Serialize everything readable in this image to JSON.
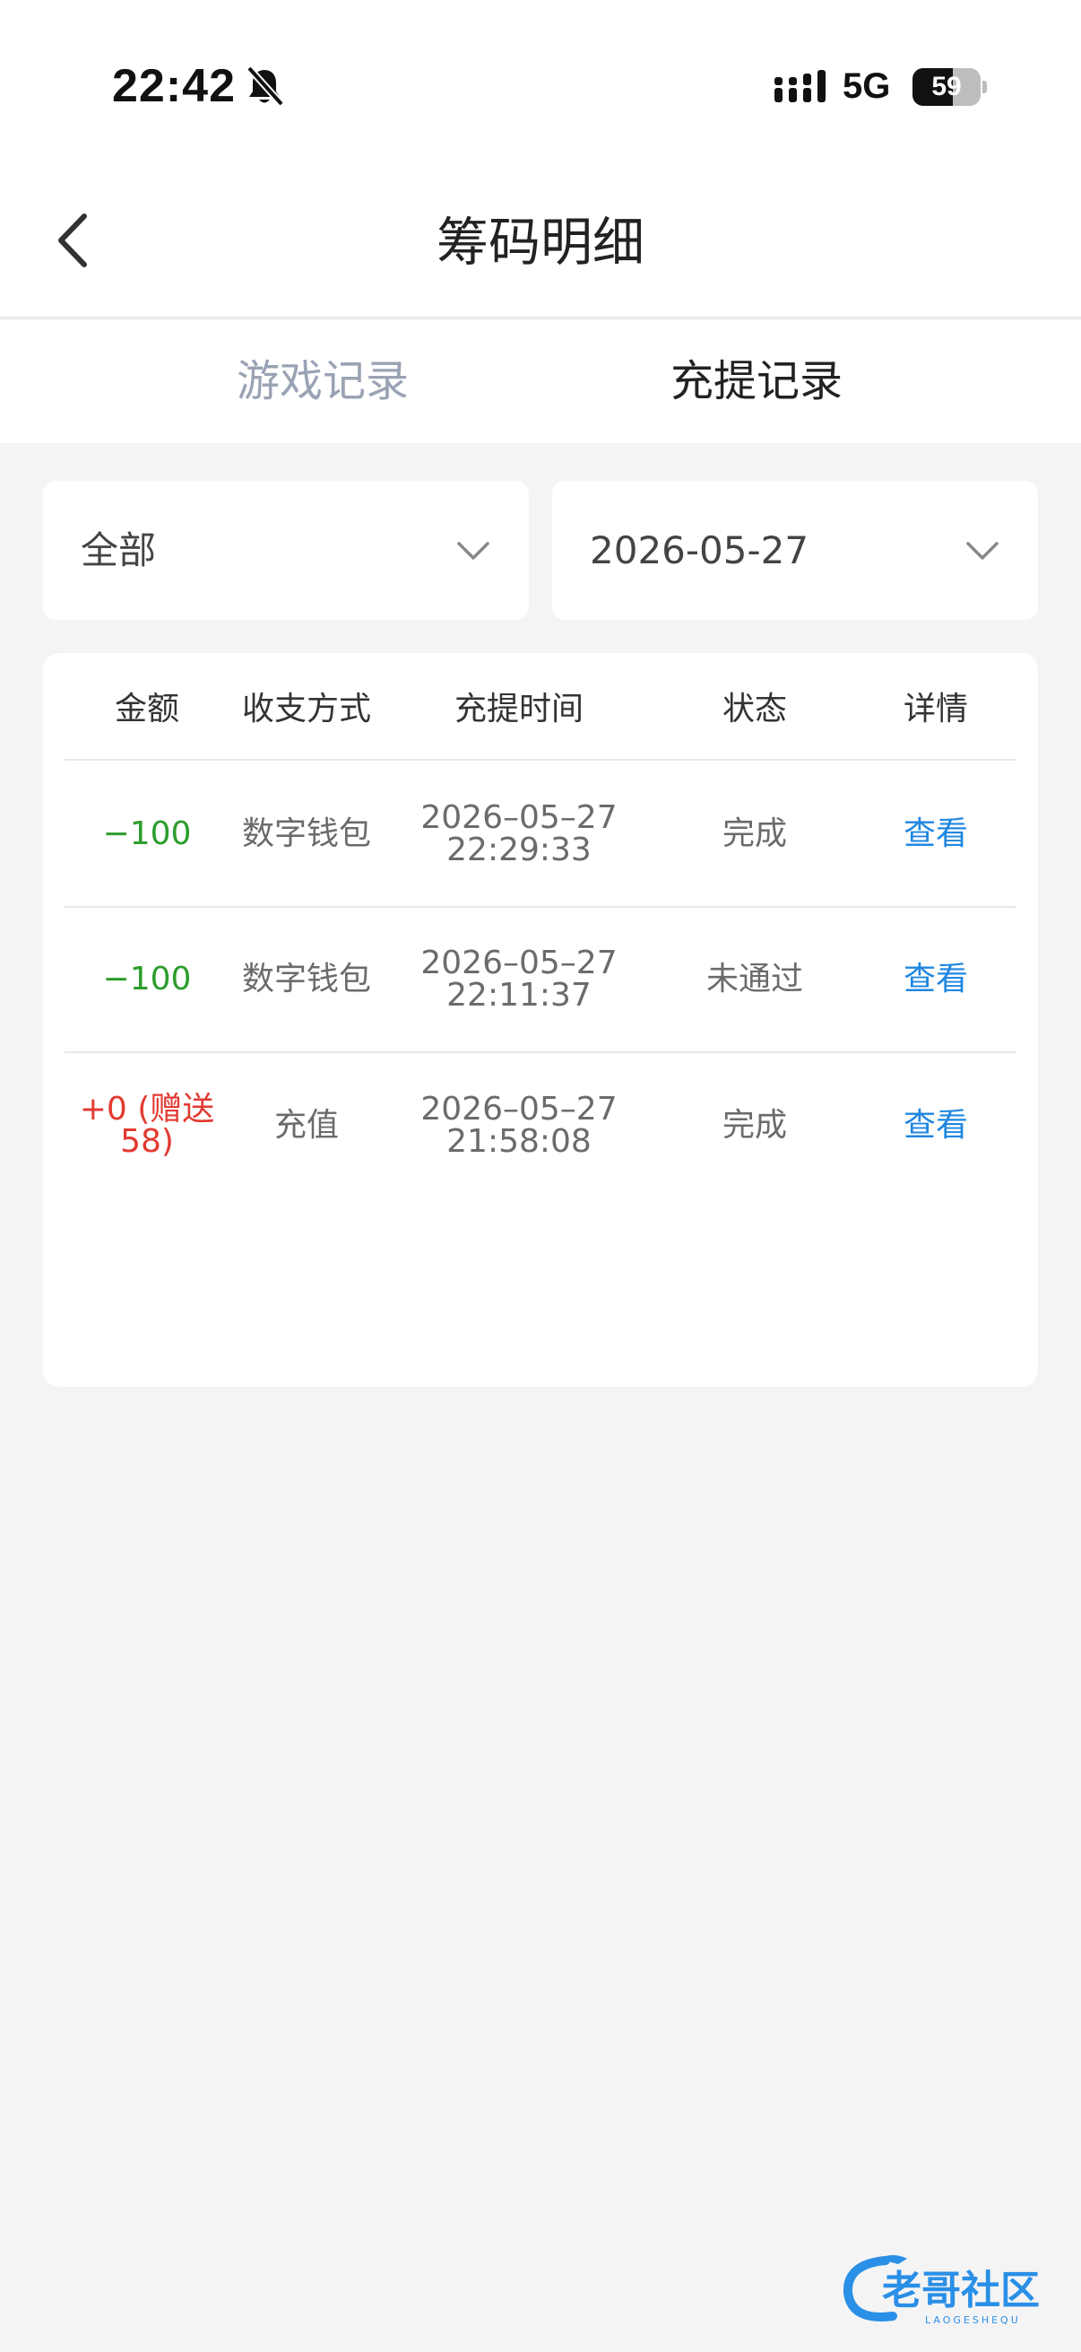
{
  "status_bar": {
    "time": "22:42",
    "network": "5G",
    "battery": "59",
    "battery_level": 0.59
  },
  "nav": {
    "title": "筹码明细"
  },
  "tabs": [
    {
      "label": "游戏记录",
      "active": false
    },
    {
      "label": "充提记录",
      "active": true
    }
  ],
  "filters": {
    "type": "全部",
    "date": "2026-05-27"
  },
  "table": {
    "headers": [
      "金额",
      "收支方式",
      "充提时间",
      "状态",
      "详情"
    ],
    "rows": [
      {
        "amount": "−100",
        "method": "数字钱包",
        "date": "2026–05–27",
        "time": "22:29:33",
        "status": "完成",
        "detail": "查看"
      },
      {
        "amount": "−100",
        "method": "数字钱包",
        "date": "2026–05–27",
        "time": "22:11:37",
        "status": "未通过",
        "detail": "查看"
      },
      {
        "amount_line1": "+0 (赠送",
        "amount_line2": "58)",
        "method": "充值",
        "date": "2026–05–27",
        "time": "21:58:08",
        "status": "完成",
        "detail": "查看"
      }
    ]
  },
  "colors": {
    "negative": "#2c9d2c",
    "positive": "#e23a31",
    "link": "#1f86e0",
    "inactive_tab": "#9aa3b4"
  },
  "watermark": {
    "text": "老哥社区",
    "subtext": "LAOGESHEQU"
  }
}
